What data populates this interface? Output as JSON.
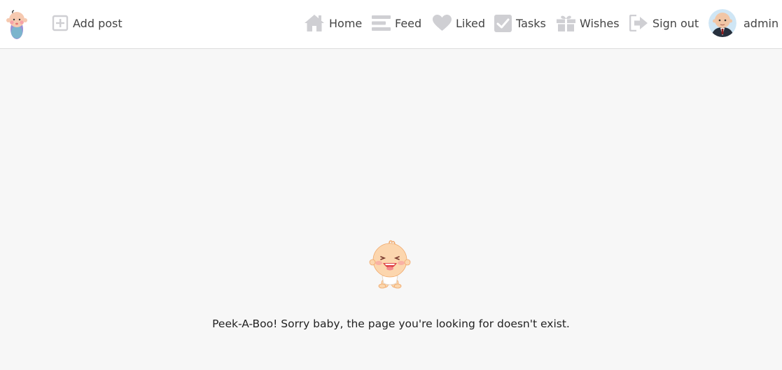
{
  "nav": {
    "add_post": "Add post",
    "home": "Home",
    "feed": "Feed",
    "liked": "Liked",
    "tasks": "Tasks",
    "wishes": "Wishes",
    "sign_out": "Sign out",
    "user": "admin"
  },
  "icons": {
    "logo": "baby-logo-icon",
    "add_post": "plus-square-icon",
    "home": "home-icon",
    "feed": "list-icon",
    "liked": "heart-icon",
    "tasks": "checkbox-icon",
    "wishes": "gift-icon",
    "sign_out": "sign-out-icon",
    "avatar": "boss-baby-avatar",
    "illustration": "laughing-baby-illustration"
  },
  "colors": {
    "icon_gray": "#cfcfd3",
    "background": "#f7f7f7",
    "header": "#ffffff"
  },
  "error": {
    "message": "Peek-A-Boo! Sorry baby, the page you're looking for doesn't exist."
  }
}
